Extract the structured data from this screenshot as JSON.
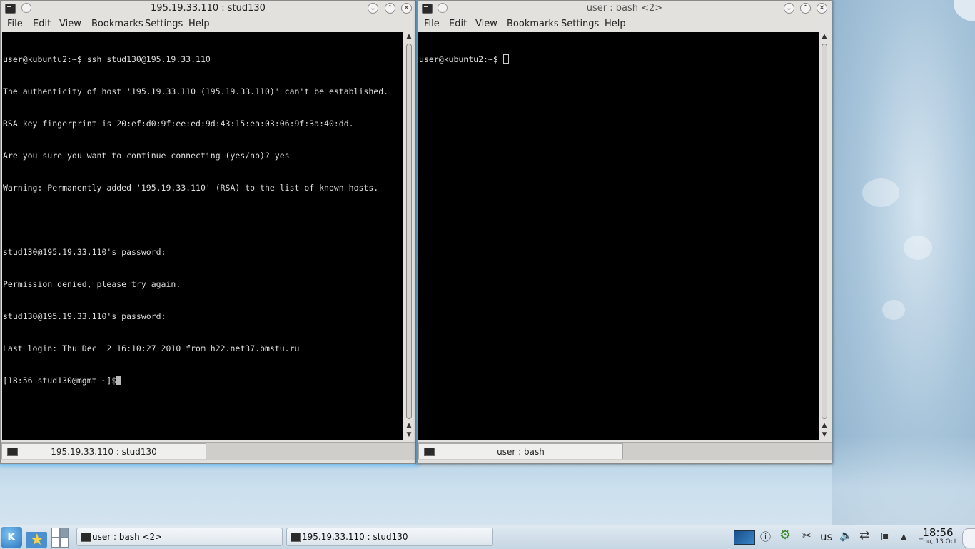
{
  "windows": {
    "left": {
      "title": "195.19.33.110 : stud130",
      "menu": [
        "File",
        "Edit",
        "View",
        "Bookmarks",
        "Settings",
        "Help"
      ],
      "lines": [
        "user@kubuntu2:~$ ssh stud130@195.19.33.110",
        "The authenticity of host '195.19.33.110 (195.19.33.110)' can't be established.",
        "RSA key fingerprint is 20:ef:d0:9f:ee:ed:9d:43:15:ea:03:06:9f:3a:40:dd.",
        "Are you sure you want to continue connecting (yes/no)? yes",
        "Warning: Permanently added '195.19.33.110' (RSA) to the list of known hosts.",
        "",
        "stud130@195.19.33.110's password:",
        "Permission denied, please try again.",
        "stud130@195.19.33.110's password:",
        "Last login: Thu Dec  2 16:10:27 2010 from h22.net37.bmstu.ru"
      ],
      "prompt": "[18:56 stud130@mgmt ~]$",
      "tab_label": "195.19.33.110 : stud130"
    },
    "right": {
      "title": "user : bash <2>",
      "menu": [
        "File",
        "Edit",
        "View",
        "Bookmarks",
        "Settings",
        "Help"
      ],
      "prompt": "user@kubuntu2:~$ ",
      "tab_label": "user : bash"
    }
  },
  "taskbar": {
    "kmenu_glyph": "K",
    "tasks": [
      "user : bash <2>",
      "195.19.33.110 : stud130"
    ],
    "keyboard_layout": "us",
    "clock_time": "18:56",
    "clock_date": "Thu, 13 Oct"
  },
  "icons": [
    "terminal-icon",
    "pin-icon",
    "minimize-icon",
    "maximize-icon",
    "close-icon",
    "favorites-star-icon",
    "network-icon",
    "volume-icon",
    "clipboard-icon",
    "usb-icon",
    "battery-icon",
    "updates-icon",
    "notifications-icon"
  ],
  "colors": {
    "terminal_bg": "#000000",
    "terminal_fg": "#dddddd",
    "active_glow": "#5fb6f0",
    "kde_blue": "#2b78c0"
  }
}
